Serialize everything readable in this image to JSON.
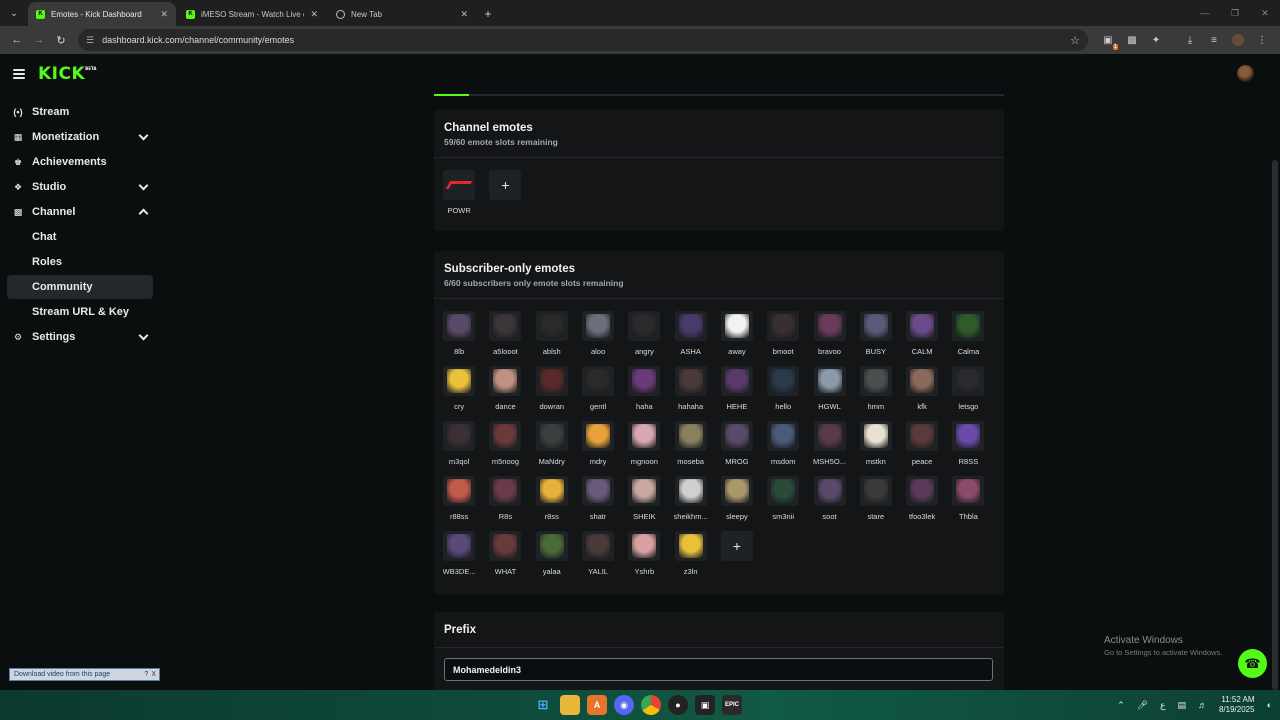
{
  "browser": {
    "tabs": [
      {
        "label": "Emotes - Kick Dashboard",
        "active": true,
        "icon": "kick-icon"
      },
      {
        "label": "iMESO Stream - Watch Live on",
        "active": false,
        "icon": "kick-icon"
      },
      {
        "label": "New Tab",
        "active": false,
        "icon": "chrome-icon"
      }
    ],
    "url": "dashboard.kick.com/channel/community/emotes",
    "extension_badge": "1"
  },
  "app": {
    "logo": "KICK",
    "logo_badge": "BETA",
    "accent_color": "#53fc18"
  },
  "sidebar": {
    "items": [
      {
        "label": "Stream",
        "icon": "broadcast-icon",
        "chevron": "none"
      },
      {
        "label": "Monetization",
        "icon": "wallet-icon",
        "chevron": "down"
      },
      {
        "label": "Achievements",
        "icon": "trophy-icon",
        "chevron": "none"
      },
      {
        "label": "Studio",
        "icon": "studio-icon",
        "chevron": "down"
      },
      {
        "label": "Channel",
        "icon": "channel-icon",
        "chevron": "up"
      }
    ],
    "channel_sub": [
      {
        "label": "Chat"
      },
      {
        "label": "Roles"
      },
      {
        "label": "Community",
        "active": true
      },
      {
        "label": "Stream URL & Key"
      }
    ],
    "settings": {
      "label": "Settings",
      "icon": "gear-icon"
    }
  },
  "channel_emotes": {
    "title": "Channel emotes",
    "subtitle": "59/60 emote slots remaining",
    "emotes": [
      {
        "name": "POWR"
      }
    ]
  },
  "subscriber_emotes": {
    "title": "Subscriber-only emotes",
    "subtitle": "6/60 subscribers only emote slots remaining",
    "emotes": [
      {
        "name": "8lb",
        "color": "#5a4a6a"
      },
      {
        "name": "a5looot",
        "color": "#3a3538"
      },
      {
        "name": "ablsh",
        "color": "#2a2a2a"
      },
      {
        "name": "aloo",
        "color": "#6a6f7a"
      },
      {
        "name": "angry",
        "color": "#2c2a2c"
      },
      {
        "name": "ASHA",
        "color": "#4a3a6a"
      },
      {
        "name": "away",
        "color": "#f2f2f2"
      },
      {
        "name": "bmoot",
        "color": "#3a2f30"
      },
      {
        "name": "bravoo",
        "color": "#6a3a5a"
      },
      {
        "name": "BUSY",
        "color": "#5a5a7a"
      },
      {
        "name": "CALM",
        "color": "#6a4a8a"
      },
      {
        "name": "Calma",
        "color": "#2f5a2a"
      },
      {
        "name": "cry",
        "color": "#e8c23a"
      },
      {
        "name": "dance",
        "color": "#c09080"
      },
      {
        "name": "dowran",
        "color": "#5a2a2a"
      },
      {
        "name": "gentl",
        "color": "#2a2a2a"
      },
      {
        "name": "haha",
        "color": "#6a3a7a"
      },
      {
        "name": "hahaha",
        "color": "#4a3a3a"
      },
      {
        "name": "HEHE",
        "color": "#5a3a6a"
      },
      {
        "name": "hello",
        "color": "#2a3a4a"
      },
      {
        "name": "HGWL",
        "color": "#8a9aa8"
      },
      {
        "name": "hmm",
        "color": "#4a5050"
      },
      {
        "name": "kfk",
        "color": "#8a6a5a"
      },
      {
        "name": "letsgo",
        "color": "#2a2a2f"
      },
      {
        "name": "m3qol",
        "color": "#3a3035"
      },
      {
        "name": "m5noog",
        "color": "#6a3a3a"
      },
      {
        "name": "MaNdry",
        "color": "#3a4040"
      },
      {
        "name": "mdry",
        "color": "#e8a23a"
      },
      {
        "name": "mgnoon",
        "color": "#d8a8b0"
      },
      {
        "name": "moseba",
        "color": "#8a8060"
      },
      {
        "name": "MROG",
        "color": "#5a4a6a"
      },
      {
        "name": "msdom",
        "color": "#4a5a7a"
      },
      {
        "name": "MSH5O...",
        "color": "#5a3a4a"
      },
      {
        "name": "mstkn",
        "color": "#e8e0d0"
      },
      {
        "name": "peace",
        "color": "#5a3a3a"
      },
      {
        "name": "R8SS",
        "color": "#6a4aaa"
      },
      {
        "name": "r88ss",
        "color": "#c05a4a"
      },
      {
        "name": "R8s",
        "color": "#6a3a4a"
      },
      {
        "name": "r8ss",
        "color": "#e8b23a"
      },
      {
        "name": "shatr",
        "color": "#6a5a7a"
      },
      {
        "name": "SHEIK",
        "color": "#c8a8a0"
      },
      {
        "name": "sheikhm...",
        "color": "#d0d0d0"
      },
      {
        "name": "sleepy",
        "color": "#a8986a"
      },
      {
        "name": "sm3nii",
        "color": "#2a4a3a"
      },
      {
        "name": "soot",
        "color": "#5a4a6a"
      },
      {
        "name": "stare",
        "color": "#3a3a3a"
      },
      {
        "name": "tfoo3lek",
        "color": "#5a3a5a"
      },
      {
        "name": "Thbla",
        "color": "#8a4a6a"
      },
      {
        "name": "WB3DE...",
        "color": "#5a4a7a"
      },
      {
        "name": "WHAT",
        "color": "#6a3a3a"
      },
      {
        "name": "yalaa",
        "color": "#4a6a3a"
      },
      {
        "name": "YALIL",
        "color": "#4a3a3a"
      },
      {
        "name": "Yshrb",
        "color": "#d8a0a0"
      },
      {
        "name": "z3ln",
        "color": "#e8c03a"
      }
    ]
  },
  "prefix": {
    "title": "Prefix",
    "value": "Mohamedeldin3"
  },
  "overlays": {
    "activate_title": "Activate Windows",
    "activate_sub": "Go to Settings to activate Windows.",
    "download_bar": "Download video from this page",
    "download_help": "?",
    "download_close": "X"
  },
  "taskbar": {
    "time": "11:52 AM",
    "date": "8/19/2025",
    "lang": "ع"
  }
}
